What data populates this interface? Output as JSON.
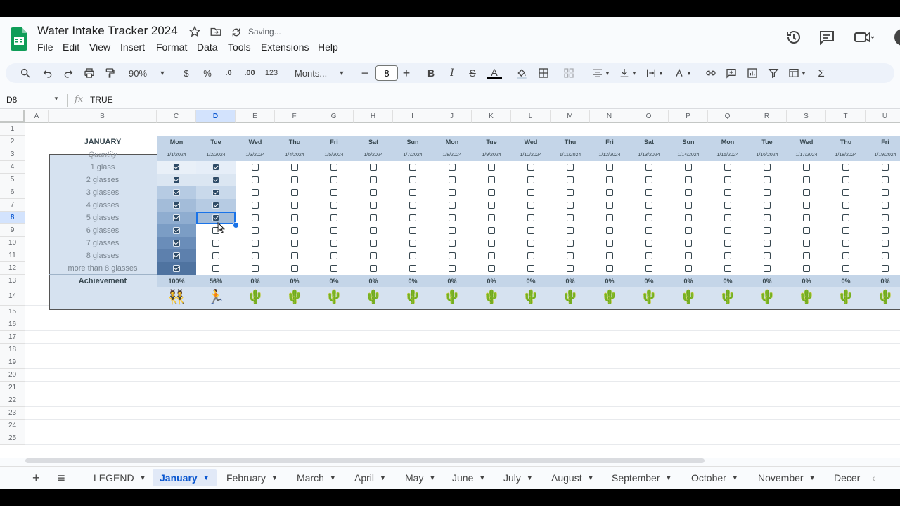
{
  "app": {
    "title": "Water Intake Tracker 2024",
    "status": "Saving...",
    "menu": [
      "File",
      "Edit",
      "View",
      "Insert",
      "Format",
      "Data",
      "Tools",
      "Extensions",
      "Help"
    ]
  },
  "toolbar": {
    "zoom": "90%",
    "currency": "$",
    "percent": "%",
    "decrease_decimal": ".0",
    "increase_decimal": ".00",
    "number_format": "123",
    "font": "Monts...",
    "font_size": "8",
    "bold": "B",
    "italic": "I",
    "strike": "S",
    "text_color": "A",
    "sum": "Σ"
  },
  "formula": {
    "cell_ref": "D8",
    "fx": "fx",
    "value": "TRUE"
  },
  "columns": [
    "A",
    "B",
    "C",
    "D",
    "E",
    "F",
    "G",
    "H",
    "I",
    "J",
    "K",
    "L",
    "M",
    "N",
    "O",
    "P",
    "Q",
    "R",
    "S",
    "T",
    "U"
  ],
  "rows": [
    "1",
    "2",
    "3",
    "4",
    "5",
    "6",
    "7",
    "8",
    "9",
    "10",
    "11",
    "12",
    "13",
    "14",
    "15",
    "16",
    "17",
    "18",
    "19",
    "20",
    "21",
    "22",
    "23",
    "24",
    "25"
  ],
  "tracker": {
    "month": "JANUARY",
    "quantity_label": "Quantity",
    "quantities": [
      "1 glass",
      "2 glasses",
      "3 glasses",
      "4 glasses",
      "5 glasses",
      "6 glasses",
      "7 glasses",
      "8 glasses",
      "more than 8 glasses"
    ],
    "achievement_label": "Achievement",
    "days": [
      {
        "day": "Mon",
        "date": "1/1/2024",
        "pct": "100%",
        "emoji": "👯",
        "checked": [
          true,
          true,
          true,
          true,
          true,
          true,
          true,
          true,
          true
        ]
      },
      {
        "day": "Tue",
        "date": "1/2/2024",
        "pct": "56%",
        "emoji": "🏃",
        "checked": [
          true,
          true,
          true,
          true,
          true,
          false,
          false,
          false,
          false
        ]
      },
      {
        "day": "Wed",
        "date": "1/3/2024",
        "pct": "0%",
        "emoji": "🌵",
        "checked": [
          false,
          false,
          false,
          false,
          false,
          false,
          false,
          false,
          false
        ]
      },
      {
        "day": "Thu",
        "date": "1/4/2024",
        "pct": "0%",
        "emoji": "🌵",
        "checked": [
          false,
          false,
          false,
          false,
          false,
          false,
          false,
          false,
          false
        ]
      },
      {
        "day": "Fri",
        "date": "1/5/2024",
        "pct": "0%",
        "emoji": "🌵",
        "checked": [
          false,
          false,
          false,
          false,
          false,
          false,
          false,
          false,
          false
        ]
      },
      {
        "day": "Sat",
        "date": "1/6/2024",
        "pct": "0%",
        "emoji": "🌵",
        "checked": [
          false,
          false,
          false,
          false,
          false,
          false,
          false,
          false,
          false
        ]
      },
      {
        "day": "Sun",
        "date": "1/7/2024",
        "pct": "0%",
        "emoji": "🌵",
        "checked": [
          false,
          false,
          false,
          false,
          false,
          false,
          false,
          false,
          false
        ]
      },
      {
        "day": "Mon",
        "date": "1/8/2024",
        "pct": "0%",
        "emoji": "🌵",
        "checked": [
          false,
          false,
          false,
          false,
          false,
          false,
          false,
          false,
          false
        ]
      },
      {
        "day": "Tue",
        "date": "1/9/2024",
        "pct": "0%",
        "emoji": "🌵",
        "checked": [
          false,
          false,
          false,
          false,
          false,
          false,
          false,
          false,
          false
        ]
      },
      {
        "day": "Wed",
        "date": "1/10/2024",
        "pct": "0%",
        "emoji": "🌵",
        "checked": [
          false,
          false,
          false,
          false,
          false,
          false,
          false,
          false,
          false
        ]
      },
      {
        "day": "Thu",
        "date": "1/11/2024",
        "pct": "0%",
        "emoji": "🌵",
        "checked": [
          false,
          false,
          false,
          false,
          false,
          false,
          false,
          false,
          false
        ]
      },
      {
        "day": "Fri",
        "date": "1/12/2024",
        "pct": "0%",
        "emoji": "🌵",
        "checked": [
          false,
          false,
          false,
          false,
          false,
          false,
          false,
          false,
          false
        ]
      },
      {
        "day": "Sat",
        "date": "1/13/2024",
        "pct": "0%",
        "emoji": "🌵",
        "checked": [
          false,
          false,
          false,
          false,
          false,
          false,
          false,
          false,
          false
        ]
      },
      {
        "day": "Sun",
        "date": "1/14/2024",
        "pct": "0%",
        "emoji": "🌵",
        "checked": [
          false,
          false,
          false,
          false,
          false,
          false,
          false,
          false,
          false
        ]
      },
      {
        "day": "Mon",
        "date": "1/15/2024",
        "pct": "0%",
        "emoji": "🌵",
        "checked": [
          false,
          false,
          false,
          false,
          false,
          false,
          false,
          false,
          false
        ]
      },
      {
        "day": "Tue",
        "date": "1/16/2024",
        "pct": "0%",
        "emoji": "🌵",
        "checked": [
          false,
          false,
          false,
          false,
          false,
          false,
          false,
          false,
          false
        ]
      },
      {
        "day": "Wed",
        "date": "1/17/2024",
        "pct": "0%",
        "emoji": "🌵",
        "checked": [
          false,
          false,
          false,
          false,
          false,
          false,
          false,
          false,
          false
        ]
      },
      {
        "day": "Thu",
        "date": "1/18/2024",
        "pct": "0%",
        "emoji": "🌵",
        "checked": [
          false,
          false,
          false,
          false,
          false,
          false,
          false,
          false,
          false
        ]
      },
      {
        "day": "Fri",
        "date": "1/19/2024",
        "pct": "0%",
        "emoji": "🌵",
        "checked": [
          false,
          false,
          false,
          false,
          false,
          false,
          false,
          false,
          false
        ]
      }
    ]
  },
  "sheets": {
    "add": "+",
    "all_sheets": "≡",
    "tabs": [
      "LEGEND",
      "January",
      "February",
      "March",
      "April",
      "May",
      "June",
      "July",
      "August",
      "September",
      "October",
      "November",
      "Decer"
    ],
    "active": "January"
  },
  "colors": {
    "accent": "#1a73e8",
    "tracker_bg": "#d6e2f0",
    "check_fill": "#2d4a66",
    "sheets_green": "#0f9d58"
  }
}
